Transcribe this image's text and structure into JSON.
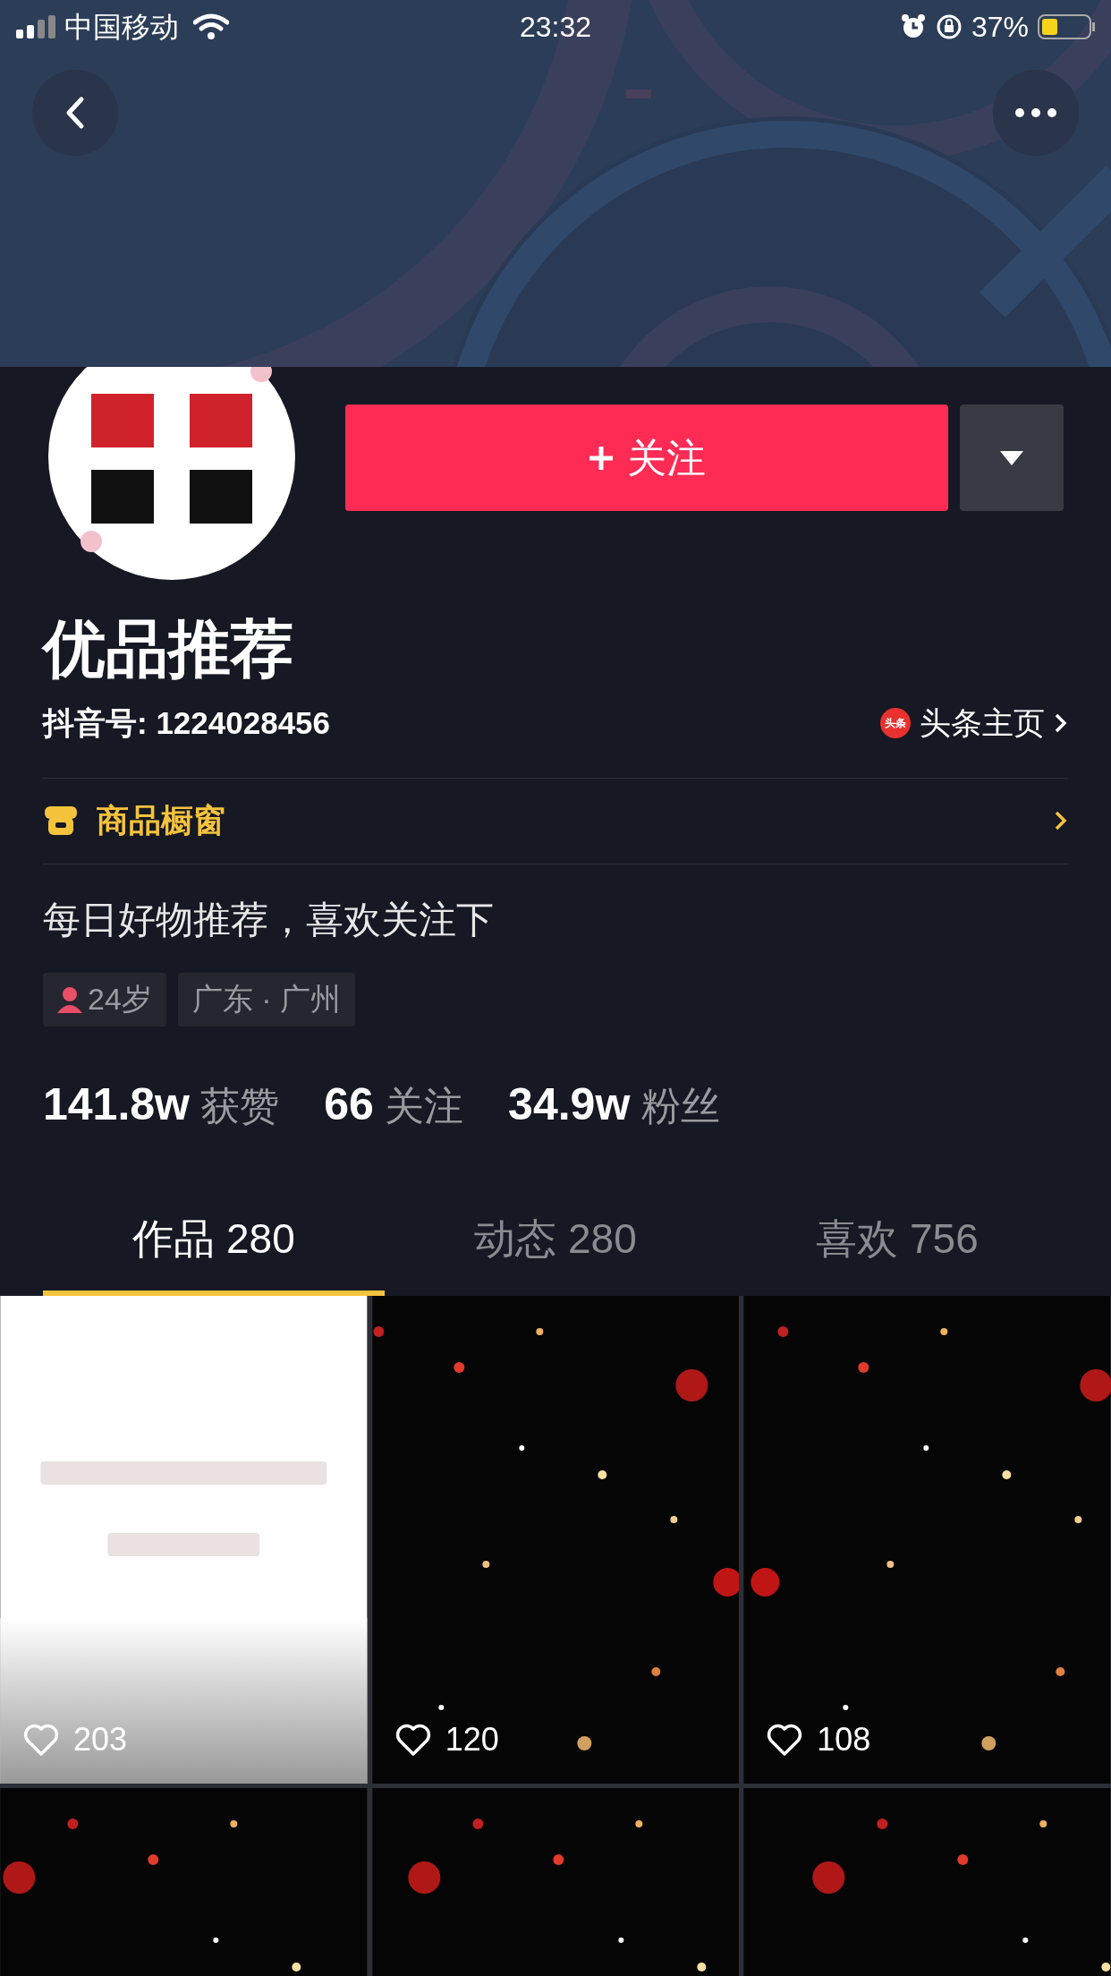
{
  "status_bar": {
    "carrier": "中国移动",
    "time": "23:32",
    "battery": "37%"
  },
  "profile": {
    "follow_label": "关注",
    "name": "优品推荐",
    "douyin_id": "抖音号: 1224028456",
    "toutiao_badge": "头条",
    "toutiao_link": "头条主页",
    "shop": "商品橱窗",
    "bio": "每日好物推荐，喜欢关注下",
    "tags": [
      {
        "kind": "age",
        "label": "24岁"
      },
      {
        "kind": "location",
        "label": "广东 · 广州"
      }
    ],
    "stats": [
      "**141.8w** 获赞",
      "**66** 关注",
      "**34.9w** 粉丝"
    ]
  },
  "tabs": [
    {
      "label": "作品 280",
      "selected": true
    },
    {
      "label": "动态 280",
      "selected": false
    },
    {
      "label": "喜欢 756",
      "selected": false
    }
  ],
  "videos": [
    {
      "kind": "light",
      "likes": "203"
    },
    {
      "kind": "dark",
      "likes": "120"
    },
    {
      "kind": "dark",
      "likes": "108"
    },
    {
      "kind": "dark"
    },
    {
      "kind": "dark"
    },
    {
      "kind": "dark"
    }
  ]
}
